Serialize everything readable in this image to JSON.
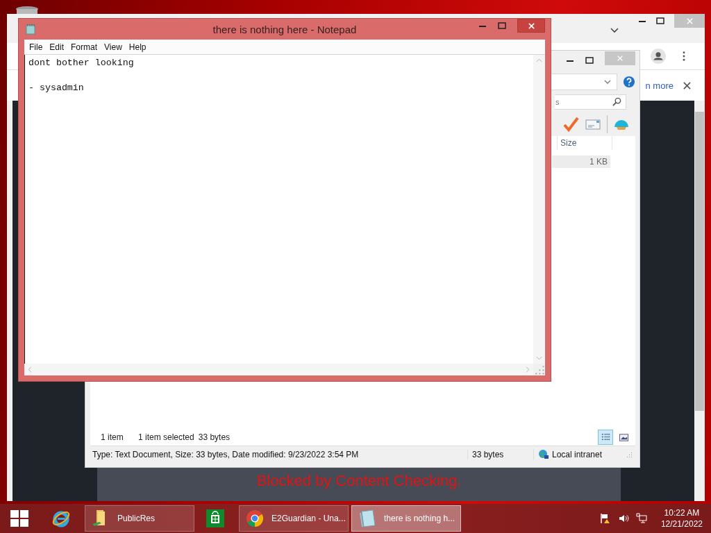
{
  "browser": {
    "infobar_link": "n more",
    "page_message": "Blocked by Content Checking."
  },
  "explorer": {
    "search_placeholder": "s",
    "column_header": "Size",
    "file_size": "1 KB",
    "item_count": "1 item",
    "selection_status": "1 item selected",
    "selection_size": "33 bytes",
    "details": "Type: Text Document, Size: 33 bytes, Date modified: 9/23/2022 3:54 PM",
    "details_size": "33 bytes",
    "zone": "Local intranet",
    "views": [
      {
        "kind": "details",
        "selected": true
      },
      {
        "kind": "preview",
        "selected": false
      }
    ]
  },
  "notepad": {
    "title": "there is nothing here - Notepad",
    "menu": [
      "File",
      "Edit",
      "Format",
      "View",
      "Help"
    ],
    "text": "dont bother looking\n\n- sysadmin"
  },
  "taskbar": {
    "items": [
      {
        "kind": "start",
        "selected": false
      },
      {
        "kind": "ie",
        "selected": false
      },
      {
        "kind": "folder",
        "label": "PublicRes",
        "selected": false
      },
      {
        "kind": "store",
        "selected": false
      },
      {
        "kind": "chrome",
        "label": "E2Guardian - Una...",
        "selected": false
      },
      {
        "kind": "notepad",
        "label": "there is nothing h...",
        "selected": true
      }
    ],
    "clock": {
      "time": "10:22 AM",
      "date": "12/21/2022"
    }
  }
}
